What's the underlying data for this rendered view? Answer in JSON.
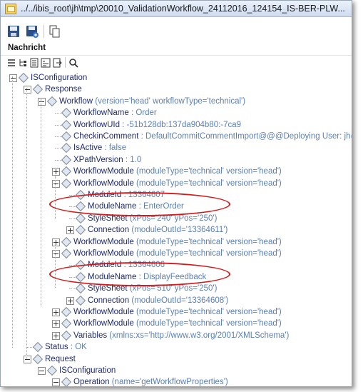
{
  "window": {
    "title": "../../ibis_root\\jh\\tmp\\20010_ValidationWorkflow_24112016_124154_IS-BER-PLW..."
  },
  "toolbar": {
    "buttons": [
      "save-icon",
      "save-all-icon",
      "copy-icon"
    ]
  },
  "section": {
    "label": "Nachricht"
  },
  "toolbar2": {
    "buttons": [
      "list-icon",
      "tree-icon",
      "text-view-icon",
      "hex-view-icon",
      "export-icon",
      "search-icon"
    ]
  },
  "tree": [
    {
      "name": "ISConfiguration",
      "attrs": "",
      "expander": "minus"
    },
    {
      "name": "Response",
      "attrs": "",
      "expander": "minus"
    },
    {
      "name": "Workflow",
      "attrs": "(version='head' workflowType='technical')",
      "expander": "minus"
    },
    {
      "name": "WorkflowName",
      "attrs": ": Order",
      "expander": "none"
    },
    {
      "name": "WorkflowUId",
      "attrs": ": -51b128db:137da904b80:-7ca9",
      "expander": "none"
    },
    {
      "name": "CheckinComment",
      "attrs": ": DefaultCommitCommentImport@@@Deploying User: jh@@@",
      "expander": "none"
    },
    {
      "name": "IsActive",
      "attrs": ": false",
      "expander": "none"
    },
    {
      "name": "XPathVersion",
      "attrs": ": 1.0",
      "expander": "none"
    },
    {
      "name": "WorkflowModule",
      "attrs": "(moduleType='technical' version='head')",
      "expander": "plus"
    },
    {
      "name": "WorkflowModule",
      "attrs": "(moduleType='technical' version='head')",
      "expander": "minus"
    },
    {
      "name": "ModuleId",
      "attrs": ": 13364607",
      "expander": "none"
    },
    {
      "name": "ModuleName",
      "attrs": ": EnterOrder",
      "expander": "none"
    },
    {
      "name": "StyleSheet",
      "attrs": "(xPos='240' yPos='250')",
      "expander": "none"
    },
    {
      "name": "Connection",
      "attrs": "(moduleOutId='13364611')",
      "expander": "plus"
    },
    {
      "name": "WorkflowModule",
      "attrs": "(moduleType='technical' version='head')",
      "expander": "plus"
    },
    {
      "name": "WorkflowModule",
      "attrs": "(moduleType='technical' version='head')",
      "expander": "minus"
    },
    {
      "name": "ModuleId",
      "attrs": ": 13364606",
      "expander": "none"
    },
    {
      "name": "ModuleName",
      "attrs": ": DisplayFeedback",
      "expander": "none"
    },
    {
      "name": "StyleSheet",
      "attrs": "(xPos='510' yPos='250')",
      "expander": "none"
    },
    {
      "name": "Connection",
      "attrs": "(moduleOutId='13364608')",
      "expander": "plus"
    },
    {
      "name": "WorkflowModule",
      "attrs": "(moduleType='technical' version='head')",
      "expander": "plus"
    },
    {
      "name": "WorkflowModule",
      "attrs": "(moduleType='technical' version='head')",
      "expander": "plus"
    },
    {
      "name": "Variables",
      "attrs": "(xmlns:xs='http://www.w3.org/2001/XMLSchema')",
      "expander": "plus"
    },
    {
      "name": "Status",
      "attrs": ": OK",
      "expander": "none"
    },
    {
      "name": "Request",
      "attrs": "",
      "expander": "minus"
    },
    {
      "name": "ISConfiguration",
      "attrs": "",
      "expander": "minus"
    },
    {
      "name": "Operation",
      "attrs": "(name='getWorkflowProperties')",
      "expander": "minus"
    }
  ],
  "highlight_color": "#d11b1b"
}
